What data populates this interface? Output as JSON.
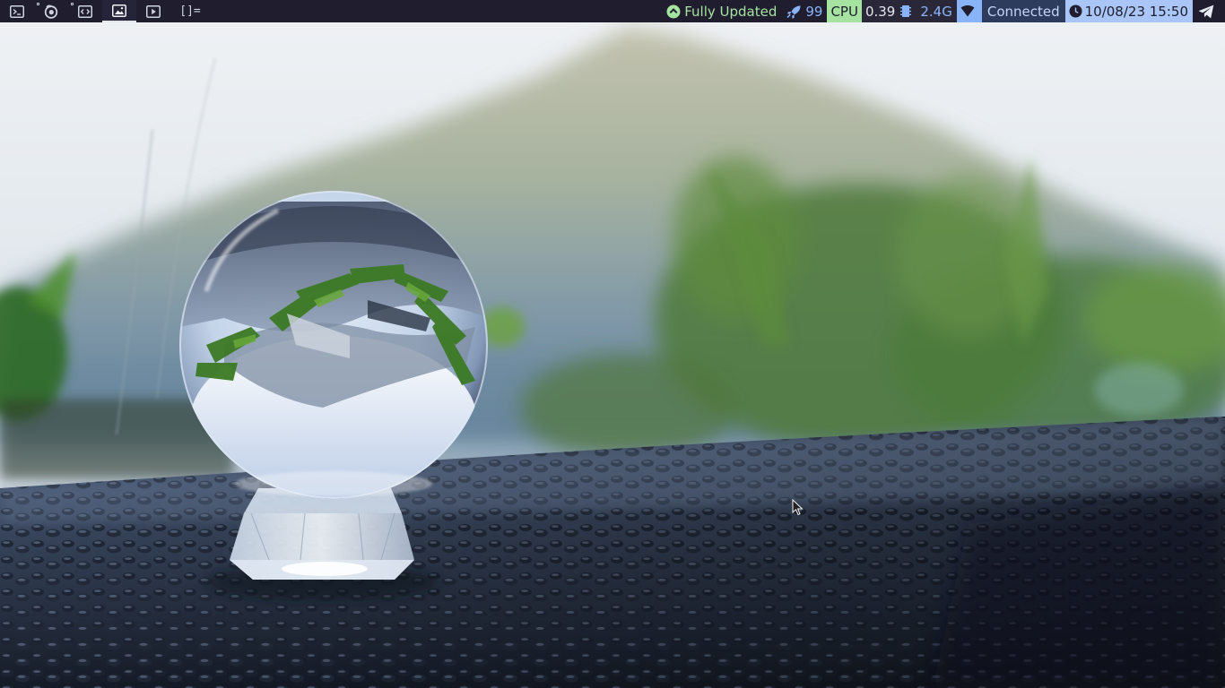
{
  "topbar": {
    "workspaces": [
      {
        "icon": "terminal-icon",
        "has_windows": false,
        "active": false
      },
      {
        "icon": "firefox-icon",
        "has_windows": true,
        "active": false
      },
      {
        "icon": "code-editor-icon",
        "has_windows": true,
        "active": false
      },
      {
        "icon": "image-viewer-icon",
        "has_windows": false,
        "active": true
      },
      {
        "icon": "media-player-icon",
        "has_windows": false,
        "active": false
      }
    ],
    "layout_indicator": "[]=",
    "updates": {
      "icon": "update-arrow-icon",
      "text": "Fully Updated",
      "color": "#a6e3a1"
    },
    "packages": {
      "icon": "rocket-icon",
      "count": "99",
      "color": "#89b4fa"
    },
    "cpu": {
      "label": "CPU",
      "value": "0.39",
      "label_bg": "#a6e3a1"
    },
    "memory": {
      "icon": "memory-chip-icon",
      "value": "2.4G"
    },
    "network": {
      "icon": "wifi-icon",
      "status": "Connected",
      "accent": "#89b4fa"
    },
    "clock": {
      "icon": "clock-icon",
      "datetime": "10/08/23 15:50",
      "bg": "#a9c6f6"
    },
    "tray": {
      "icon": "telegram-icon"
    }
  },
  "colors": {
    "bar_bg": "#1f1d2e",
    "green": "#a6e3a1",
    "blue": "#89b4fa"
  },
  "wallpaper": {
    "subject": "crystal-ball-on-pebbles"
  }
}
